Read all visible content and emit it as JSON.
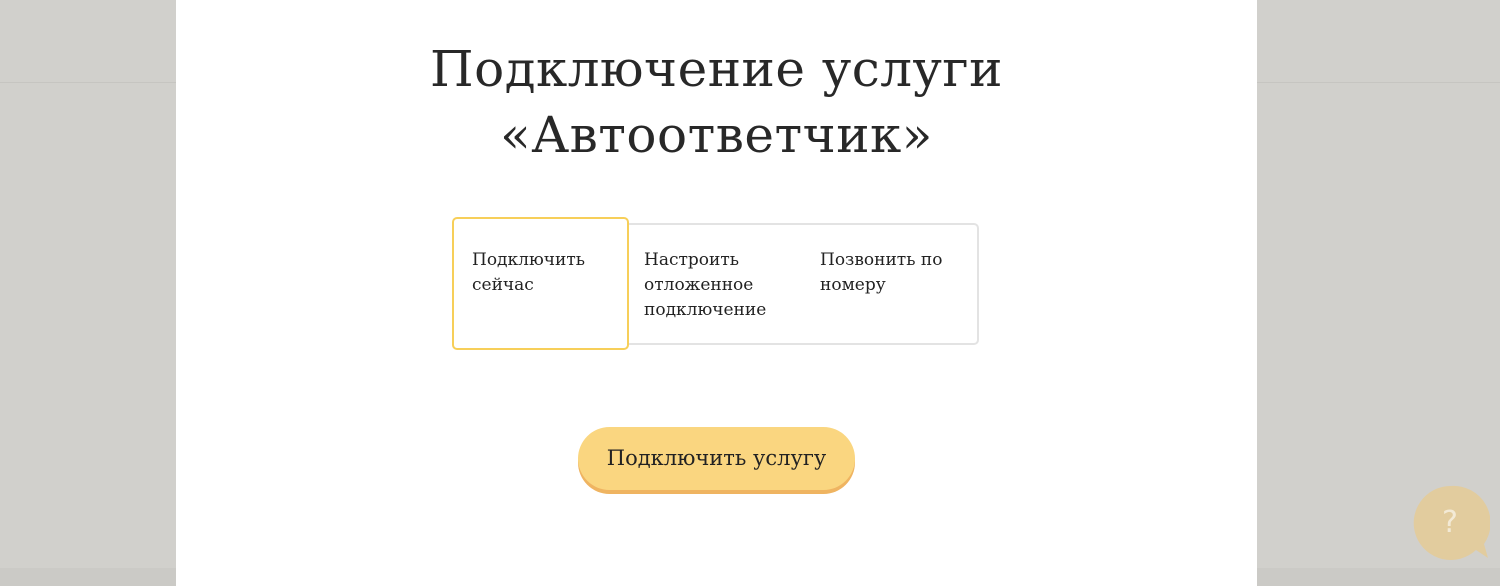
{
  "modal": {
    "title_line1": "Подключение услуги",
    "title_line2": "«Автоответчик»",
    "options": [
      {
        "label": "Подключить сейчас",
        "selected": true
      },
      {
        "label": "Настроить отложенное подключение",
        "selected": false
      },
      {
        "label": "Позвонить по номеру",
        "selected": false
      }
    ],
    "submit_label": "Подключить услугу"
  },
  "help": {
    "icon": "question-chat-icon",
    "glyph": "?"
  },
  "colors": {
    "accent_yellow": "#fad680",
    "accent_shadow": "#efb461",
    "selected_border": "#f7cf59",
    "overlay": "#d1d0cc"
  }
}
